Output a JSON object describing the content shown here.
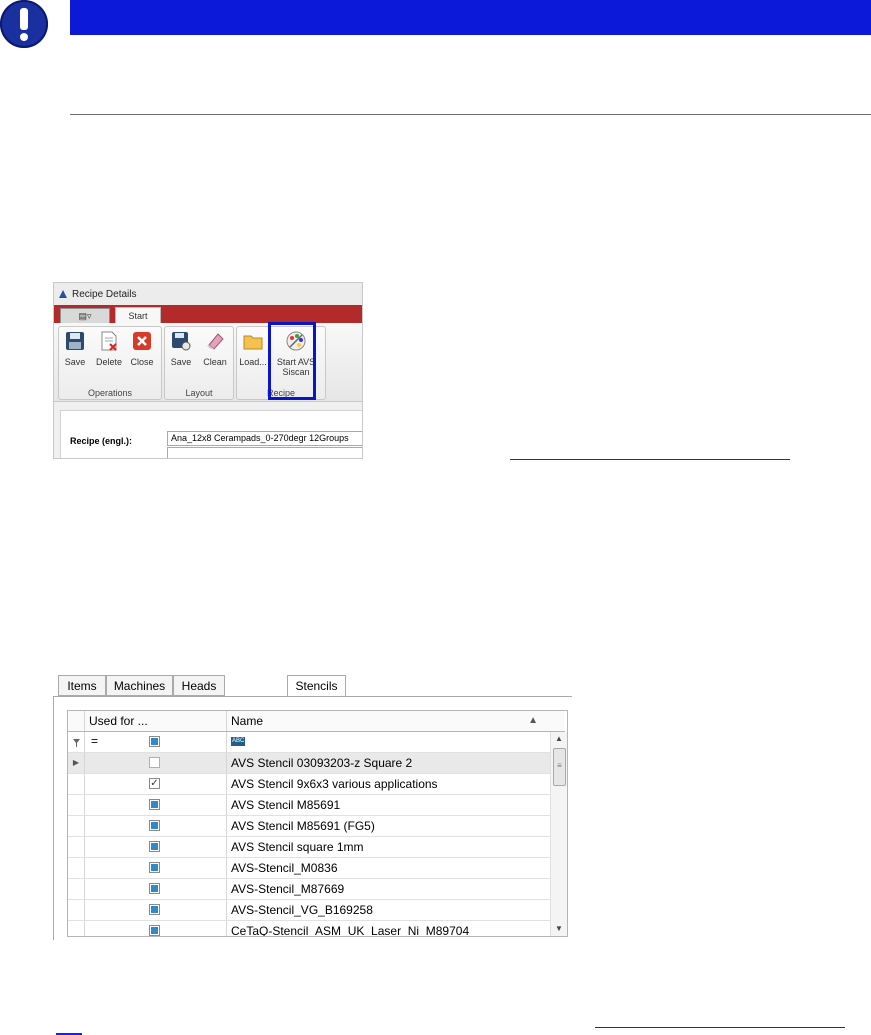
{
  "recipe_window": {
    "title": "Recipe Details",
    "quick_access": "▤▿",
    "tab_start": "Start",
    "groups": {
      "operations": {
        "label": "Operations",
        "save": "Save",
        "delete": "Delete",
        "close": "Close"
      },
      "layout": {
        "label": "Layout",
        "save": "Save",
        "clean": "Clean"
      },
      "recipe": {
        "label": "Recipe",
        "load": "Load...",
        "start_avs_1": "Start AVS",
        "start_avs_2": "Siscan"
      }
    },
    "recipe_label": "Recipe (engl.):",
    "recipe_value": "Ana_12x8 Cerampads_0-270degr 12Groups"
  },
  "stencils": {
    "tabs": [
      "Items",
      "Machines",
      "Heads",
      "Stencils"
    ],
    "active_tab": "Stencils",
    "columns": {
      "used_for": "Used for ...",
      "name": "Name"
    },
    "filter": {
      "operator": "=",
      "text_icon": "ABC"
    },
    "rows": [
      {
        "name": "AVS Stencil 03093203-z Square 2",
        "state": "unchecked",
        "selected": true
      },
      {
        "name": "AVS Stencil 9x6x3 various applications",
        "state": "checked",
        "selected": false
      },
      {
        "name": "AVS Stencil M85691",
        "state": "blue",
        "selected": false
      },
      {
        "name": "AVS Stencil M85691 (FG5)",
        "state": "blue",
        "selected": false
      },
      {
        "name": "AVS Stencil square 1mm",
        "state": "blue",
        "selected": false
      },
      {
        "name": "AVS-Stencil_M0836",
        "state": "blue",
        "selected": false
      },
      {
        "name": "AVS-Stencil_M87669",
        "state": "blue",
        "selected": false
      },
      {
        "name": "AVS-Stencil_VG_B169258",
        "state": "blue",
        "selected": false
      },
      {
        "name": "CeTaQ-Stencil_ASM_UK_Laser_Ni_M89704",
        "state": "blue",
        "selected": false
      }
    ]
  },
  "colors": {
    "notice_bar": "#0d19d8",
    "ribbon_red": "#b22a2a",
    "highlight": "#0a14c8"
  }
}
